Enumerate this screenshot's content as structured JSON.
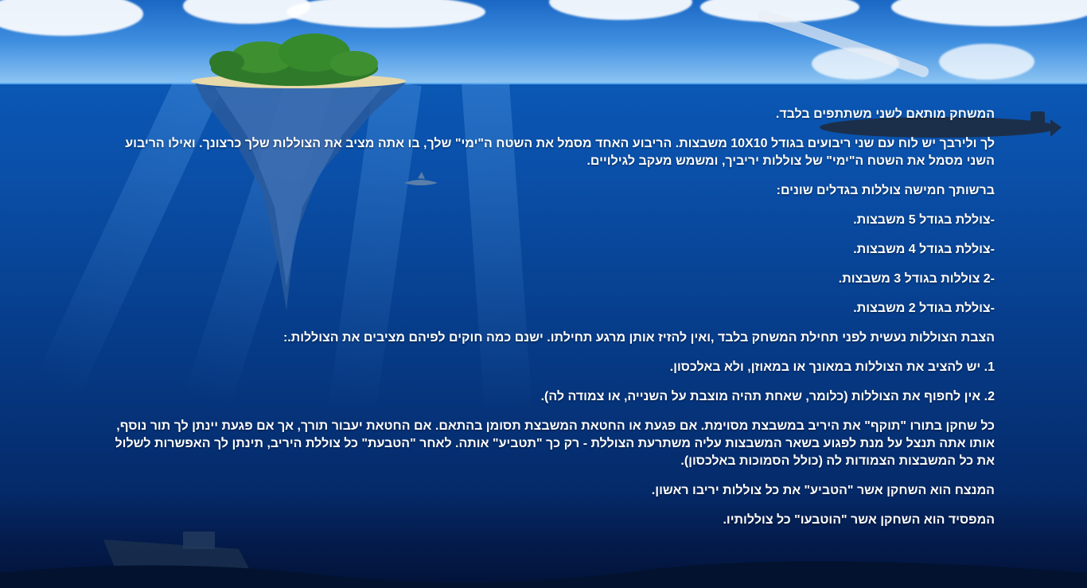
{
  "rules": {
    "paragraphs": [
      "המשחק מותאם לשני משתתפים בלבד.",
      "לך ולירבך יש לוח עם שני ריבועים בגודל 10X10 משבצות. הריבוע האחד מסמל את השטח ה\"ימי\" שלך, בו אתה מציב את הצוללות שלך כרצונך. ואילו הריבוע השני מסמל את השטח ה\"ימי\" של צוללות יריביך, ומשמש מעקב לגילויים.",
      "ברשותך חמישה צוללות בגדלים שונים:",
      "-צוללת בגודל 5 משבצות.",
      "-צוללת בגודל 4 משבצות.",
      "-2 צוללות בגודל 3 משבצות.",
      "-צוללת בגודל 2 משבצות.",
      "הצבת הצוללות נעשית לפני תחילת המשחק בלבד ,ואין להזיז אותן מרגע תחילתו. ישנם כמה חוקים לפיהם מציבים את הצוללות.:",
      "1. יש להציב את הצוללות במאונך או במאוזן, ולא באלכסון.",
      "2. אין לחפוף את הצוללות (כלומר, שאחת תהיה מוצבת על השנייה, או צמודה לה).",
      "כל שחקן בתורו \"תוקף\" את היריב במשבצת מסוימת. אם פגעת או החטאת המשבצת תסומן בהתאם. אם החטאת יעבור תורך, אך אם פגעת יינתן לך תור נוסף, אותו אתה תנצל על מנת לפגוע בשאר המשבצות עליה משתרעת הצוללת - רק כך \"תטביע\" אותה. לאחר \"הטבעת\" כל צוללת היריב, תינתן לך האפשרות לשלול את כל המשבצות הצמודות לה (כולל הסמוכות באלכסון).",
      "המנצח הוא השחקן אשר \"הטביע\" את כל צוללות יריבו ראשון.",
      "המפסיד הוא השחקן אשר \"הוטבעו\" כל צוללותיו."
    ]
  },
  "colors": {
    "text": "#ffffff",
    "sea": "#0a4fa8",
    "sky": "#3e8ee0"
  }
}
